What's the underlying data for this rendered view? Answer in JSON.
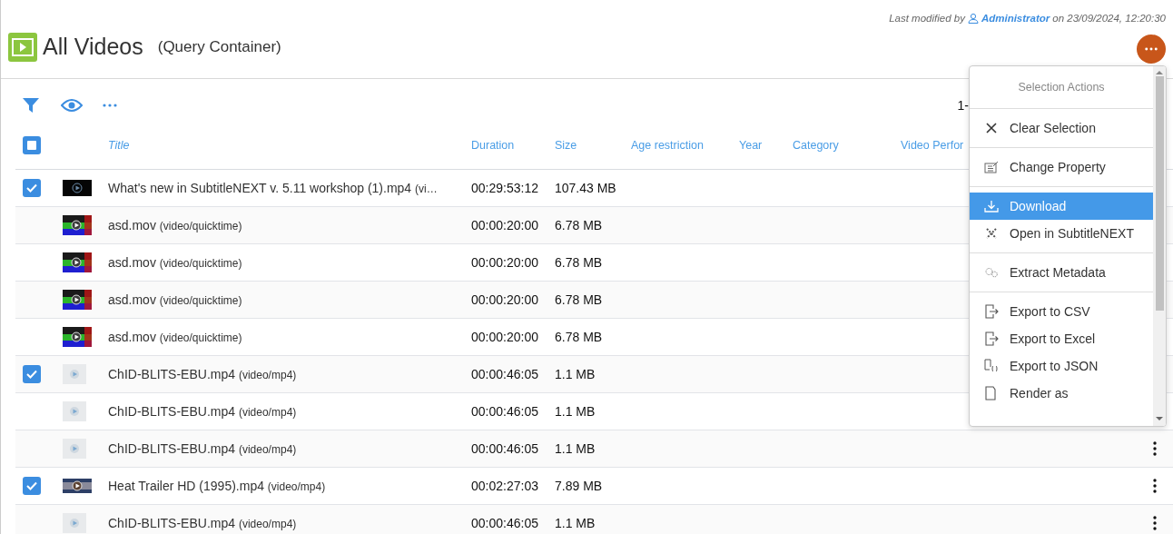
{
  "modified": {
    "prefix": "Last modified by",
    "user": "Administrator",
    "suffix": "on 23/09/2024, 12:20:30"
  },
  "title": "All Videos",
  "subtitle": "(Query Container)",
  "pager": "1-",
  "table": {
    "select_all_indeterminate": true,
    "columns": [
      "Title",
      "Duration",
      "Size",
      "Age restriction",
      "Year",
      "Category",
      "Video Perfor"
    ],
    "rows": [
      {
        "checked": true,
        "kind": "dark",
        "name": "What's new in SubtitleNEXT v. 5.11 workshop (1).mp4",
        "mime": "(vi…",
        "duration": "00:29:53:12",
        "size": "107.43 MB"
      },
      {
        "checked": false,
        "kind": "rgb",
        "name": "asd.mov",
        "mime": "(video/quicktime)",
        "duration": "00:00:20:00",
        "size": "6.78 MB"
      },
      {
        "checked": false,
        "kind": "rgb",
        "name": "asd.mov",
        "mime": "(video/quicktime)",
        "duration": "00:00:20:00",
        "size": "6.78 MB"
      },
      {
        "checked": false,
        "kind": "rgb",
        "name": "asd.mov",
        "mime": "(video/quicktime)",
        "duration": "00:00:20:00",
        "size": "6.78 MB"
      },
      {
        "checked": false,
        "kind": "rgb",
        "name": "asd.mov",
        "mime": "(video/quicktime)",
        "duration": "00:00:20:00",
        "size": "6.78 MB"
      },
      {
        "checked": true,
        "kind": "light",
        "name": "ChID-BLITS-EBU.mp4",
        "mime": "(video/mp4)",
        "duration": "00:00:46:05",
        "size": "1.1 MB"
      },
      {
        "checked": false,
        "kind": "light",
        "name": "ChID-BLITS-EBU.mp4",
        "mime": "(video/mp4)",
        "duration": "00:00:46:05",
        "size": "1.1 MB"
      },
      {
        "checked": false,
        "kind": "light",
        "name": "ChID-BLITS-EBU.mp4",
        "mime": "(video/mp4)",
        "duration": "00:00:46:05",
        "size": "1.1 MB"
      },
      {
        "checked": true,
        "kind": "trailer",
        "name": "Heat Trailer HD (1995).mp4",
        "mime": "(video/mp4)",
        "duration": "00:02:27:03",
        "size": "7.89 MB"
      },
      {
        "checked": false,
        "kind": "light",
        "name": "ChID-BLITS-EBU.mp4",
        "mime": "(video/mp4)",
        "duration": "00:00:46:05",
        "size": "1.1 MB"
      }
    ]
  },
  "menu": {
    "header": "Selection Actions",
    "groups": [
      [
        {
          "kind": "close",
          "label": "Clear Selection",
          "selected": false
        }
      ],
      [
        {
          "kind": "edit",
          "label": "Change Property",
          "selected": false
        }
      ],
      [
        {
          "kind": "download",
          "label": "Download",
          "selected": true
        },
        {
          "kind": "open",
          "label": "Open in SubtitleNEXT",
          "selected": false
        }
      ],
      [
        {
          "kind": "gears",
          "label": "Extract Metadata",
          "selected": false
        }
      ],
      [
        {
          "kind": "export",
          "label": "Export to CSV",
          "selected": false
        },
        {
          "kind": "export",
          "label": "Export to Excel",
          "selected": false
        },
        {
          "kind": "json",
          "label": "Export to JSON",
          "selected": false
        },
        {
          "kind": "file",
          "label": "Render as",
          "selected": false
        }
      ]
    ]
  }
}
